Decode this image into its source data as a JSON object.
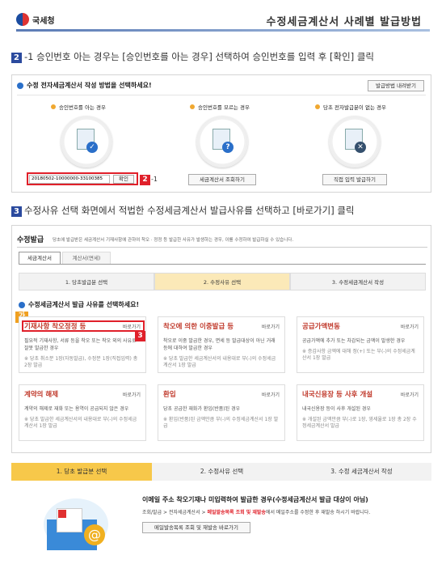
{
  "header": {
    "logo": "국세청",
    "title": "수정세금계산서 사례별 발급방법"
  },
  "step2": {
    "num": "2",
    "text": "-1 승인번호 아는 경우는 [승인번호를 아는 경우] 선택하여 승인번호를 입력 후 [확인] 클릭"
  },
  "panel1": {
    "heading": "수정 전자세금계산서 작성 방법을 선택하세요!",
    "help_btn": "발급방법 내려받기",
    "col1": {
      "label": "승인번호를 아는 경우",
      "input_value": "20180502-10000000-33100385",
      "confirm": "확인"
    },
    "col2": {
      "label": "승인번호를 모르는 경우",
      "btn": "세금계산서 조회하기"
    },
    "col3": {
      "label": "당초 전자발급분이 없는 경우",
      "btn": "직접 입력 발급하기"
    },
    "marker": "2",
    "marker_suffix": "-1"
  },
  "step3": {
    "num": "3",
    "text": "수정사유 선택 화면에서 적법한 수정세금계산서 발급사유를 선택하고 [바로가기] 클릭"
  },
  "panel2": {
    "title": "수정발급",
    "desc": "당초에 발급받은 세금계산서 기재사항에 관하여 착오 · 정정 등 발급한 사유가 발생하는 경우, 이를 수정하여 발급하실 수 있습니다.",
    "tabs": [
      "세금계산서",
      "계산서(면세)"
    ],
    "steps": [
      "1. 당초발급분 선택",
      "2. 수정사유 선택",
      "3. 수정세금계산서 작성"
    ],
    "select_heading": "수정세금계산서 발급 사유를 선택하세요!",
    "marker_ga": "가",
    "marker_3": "3",
    "cards": [
      {
        "title": "기재사항 착오정정 등",
        "go": "바로가기",
        "desc": "필요적 기재사항, 서류 등을 착오 또는 착오 외의 사유로 잘못 발급한 경우",
        "note": "※ 당초 취소분 1장(자동발급), 수정분 1장(직접입력) 총 2장 발급"
      },
      {
        "title": "착오에 의한 이중발급 등",
        "go": "바로가기",
        "desc": "착오로 이중 발급한 경우, 면세 등 발급대상이 아닌 거래 등에 대하여 발급한 경우",
        "note": "※ 당초 발급한 세금계산서의 내용대로 부(-)의 수정세금계산서 1장 발급"
      },
      {
        "title": "공급가액변동",
        "go": "바로가기",
        "desc": "공급가액에 추가 또는 차감되는 금액이 발생한 경우",
        "note": "※ 증감사항 금액에 대해 정(+) 또는 부(-)의 수정세금계산서 1장 발급"
      },
      {
        "title": "계약의 해제",
        "go": "바로가기",
        "desc": "계약의 해제로 재화 또는 용역이 공급되지 않은 경우",
        "note": "※ 당초 발급한 세금계산서의 내용대로 부(-)의 수정세금계산서 1장 발급"
      },
      {
        "title": "환입",
        "go": "바로가기",
        "desc": "당초 공급한 재화가 환입(반품)된 경우",
        "note": "※ 환입(반품)된 금액만큼 부(-)의 수정세금계산서 1장 발급"
      },
      {
        "title": "내국신용장 등 사후 개설",
        "go": "바로가기",
        "desc": "내국신용장 등이 사후 개설된 경우",
        "note": "※ 개설된 금액만큼 부(-)로 1장, 영세율로 1장 총 2장 수정세금계산서 발급"
      }
    ]
  },
  "bottom_steps": [
    "1. 당초 발급분 선택",
    "2. 수정사유 선택",
    "3. 수정 세금계산서 작성"
  ],
  "email": {
    "title": "이메일 주소 착오기재나 미입력하여 발급한 경우(수정세금계산서 발급 대상이 아님)",
    "body_pre": "조회/발급 > 전자세금계산서 > ",
    "body_red": "메일발송목록 조회 및 재발송",
    "body_post": "에서 메일주소를 수정한 후 재발송 하시기 바랍니다.",
    "btn": "메일발송목록 조회 및 재발송 바로가기"
  },
  "colors": {
    "accent": "#2b4a9e",
    "red": "#e0202a",
    "step_active": "#fbe9b8"
  }
}
